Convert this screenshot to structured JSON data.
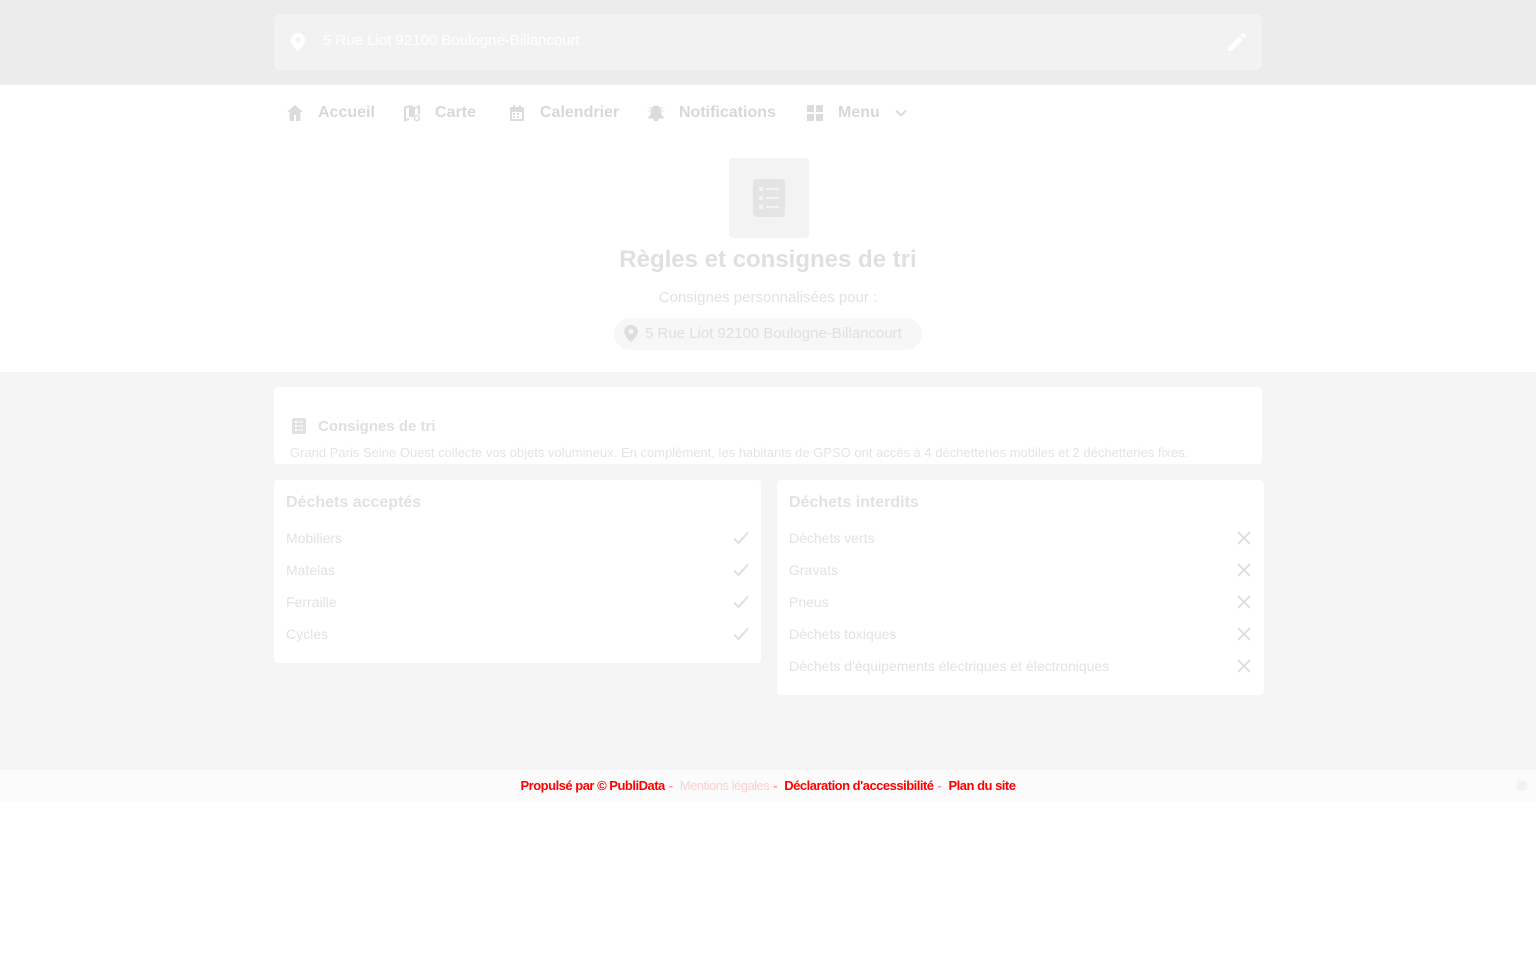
{
  "address_bar": {
    "address": "5 Rue Liot 92100 Boulogne-Billancourt",
    "pin_icon": "map-pin-icon",
    "edit_icon": "pencil-icon"
  },
  "nav": {
    "items": [
      {
        "label": "Accueil",
        "icon": "home-icon"
      },
      {
        "label": "Carte",
        "icon": "map-icon"
      },
      {
        "label": "Calendrier",
        "icon": "calendar-icon"
      },
      {
        "label": "Notifications",
        "icon": "bell-icon"
      },
      {
        "label": "Menu",
        "icon": "grid-icon",
        "dropdown_icon": "chevron-down-icon"
      }
    ]
  },
  "hero": {
    "icon": "checklist-icon",
    "title": "Règles et consignes de tri",
    "subtitle": "Consignes personnalisées pour :",
    "address": "5 Rue Liot 92100 Boulogne-Billancourt"
  },
  "consignes": {
    "title": "Consignes de tri",
    "description": "Grand Paris Seine Ouest collecte vos objets volumineux. En complément, les habitants de GPSO ont accès à 4 déchetteries mobiles et 2 déchetteries fixes."
  },
  "accepted": {
    "title": "Déchets acceptés",
    "items": [
      "Mobiliers",
      "Matelas",
      "Ferraille",
      "Cycles"
    ],
    "icon": "check-icon"
  },
  "forbidden": {
    "title": "Déchets interdits",
    "items": [
      "Déchets verts",
      "Gravats",
      "Pneus",
      "Déchets toxiques",
      "Déchets d'équipements électriques et électroniques"
    ],
    "icon": "close-icon"
  },
  "footer": {
    "links": [
      "Propulsé par",
      "© PubliData",
      "Mentions légales",
      "Déclaration d'accessibilité",
      "Plan du site"
    ]
  },
  "colors": {
    "top_band": "#ececec",
    "footer_link": "#ff0000",
    "content_bg": "#f5f5f5"
  }
}
